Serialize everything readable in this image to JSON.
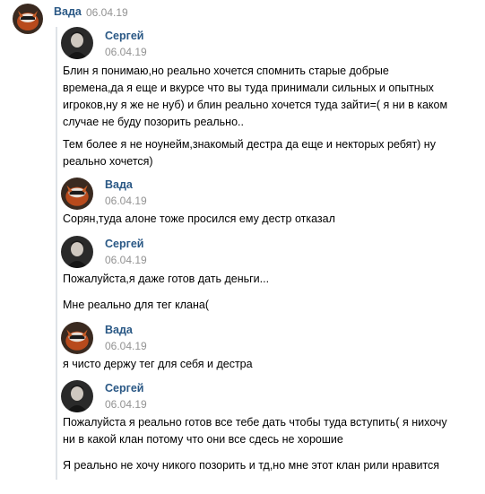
{
  "header": {
    "author": "Вада",
    "date": "06.04.19"
  },
  "messages": [
    {
      "author": "Сергей",
      "date": "06.04.19",
      "avatar": "sergey-avatar",
      "paragraphs": [
        [
          "Блин я понимаю,но реально хочется спомнить старые добрые",
          "времена,да я еще и вкурсе что вы туда принимали сильных и опытных",
          "игроков,ну я же не нуб) и блин реально хочется туда зайти=( я ни в каком",
          "случае не буду позорить реально.."
        ],
        [
          "Тем более я не ноунейм,знакомый дестра да еще и некторых ребят) ну",
          "реально хочется)"
        ]
      ]
    },
    {
      "author": "Вада",
      "date": "06.04.19",
      "avatar": "vada-avatar",
      "paragraphs": [
        [
          "Сорян,туда алоне тоже просился ему дестр отказал"
        ]
      ]
    },
    {
      "author": "Сергей",
      "date": "06.04.19",
      "avatar": "sergey-avatar",
      "paragraphs": [
        [
          "Пожалуйста,я даже готов дать деньги..."
        ],
        [
          "Мне реально для тег клана("
        ]
      ]
    },
    {
      "author": "Вада",
      "date": "06.04.19",
      "avatar": "vada-avatar",
      "paragraphs": [
        [
          "я чисто держу тег для себя и дестра"
        ]
      ]
    },
    {
      "author": "Сергей",
      "date": "06.04.19",
      "avatar": "sergey-avatar",
      "paragraphs": [
        [
          "Пожалуйста я реально готов все тебе дать чтобы туда вступить( я нихочу",
          "ни в какой клан потому что они все сдесь не хорошие"
        ],
        [
          "Я реально не хочу никого позорить и тд,но мне этот клан рили нравится"
        ]
      ]
    }
  ],
  "colors": {
    "name": "#2a5885",
    "date": "#939393",
    "quote_bar": "#dfe3e8"
  }
}
